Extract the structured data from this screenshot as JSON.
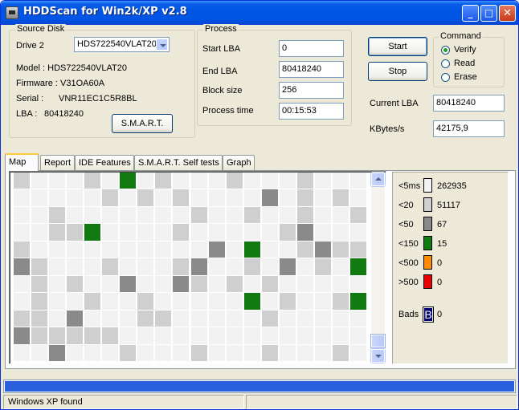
{
  "window": {
    "title": "HDDScan for Win2k/XP  v2.8",
    "controls": {
      "minimize": "_",
      "maximize": "□",
      "close": "✕"
    }
  },
  "source_disk": {
    "title": "Source Disk",
    "drive_label": "Drive  2",
    "drive_selected": "HDS722540VLAT20",
    "model": "Model : HDS722540VLAT20",
    "firmware": "Firmware : V31OA60A",
    "serial_label": "Serial :",
    "serial_value": "VNR11EC1C5R8BL",
    "lba_label": "LBA :",
    "lba_value": "80418240",
    "smart_button": "S.M.A.R.T."
  },
  "process": {
    "title": "Process",
    "start_lba_label": "Start LBA",
    "start_lba": "0",
    "end_lba_label": "End LBA",
    "end_lba": "80418240",
    "block_size_label": "Block size",
    "block_size": "256",
    "process_time_label": "Process time",
    "process_time": "00:15:53",
    "start_button": "Start",
    "stop_button": "Stop",
    "current_lba_label": "Current LBA",
    "current_lba": "80418240",
    "kbytes_label": "KBytes/s",
    "kbytes": "42175,9"
  },
  "command": {
    "title": "Command",
    "options": [
      "Verify",
      "Read",
      "Erase"
    ],
    "selected": "Verify"
  },
  "tabs": [
    "Map",
    "Report",
    "IDE Features",
    "S.M.A.R.T. Self tests",
    "Graph"
  ],
  "active_tab": "Map",
  "legend": [
    {
      "label": "<5ms",
      "count": "262935",
      "color": "#f2f2f2"
    },
    {
      "label": "<20",
      "count": "51117",
      "color": "#cfcfcf"
    },
    {
      "label": "<50",
      "count": "67",
      "color": "#8a8a8a"
    },
    {
      "label": "<150",
      "count": "15",
      "color": "#117a11"
    },
    {
      "label": "<500",
      "count": "0",
      "color": "#ff8a00"
    },
    {
      "label": ">500",
      "count": "0",
      "color": "#e60000"
    }
  ],
  "bads": {
    "label": "Bads",
    "glyph": "B",
    "count": "0",
    "color": "#00006e"
  },
  "map": {
    "cols": 20,
    "rows": 11
  },
  "progress": {
    "fraction": 1.0,
    "color": "#2b5fdb"
  },
  "status": {
    "text": "Windows XP found",
    "second_pane": ""
  }
}
